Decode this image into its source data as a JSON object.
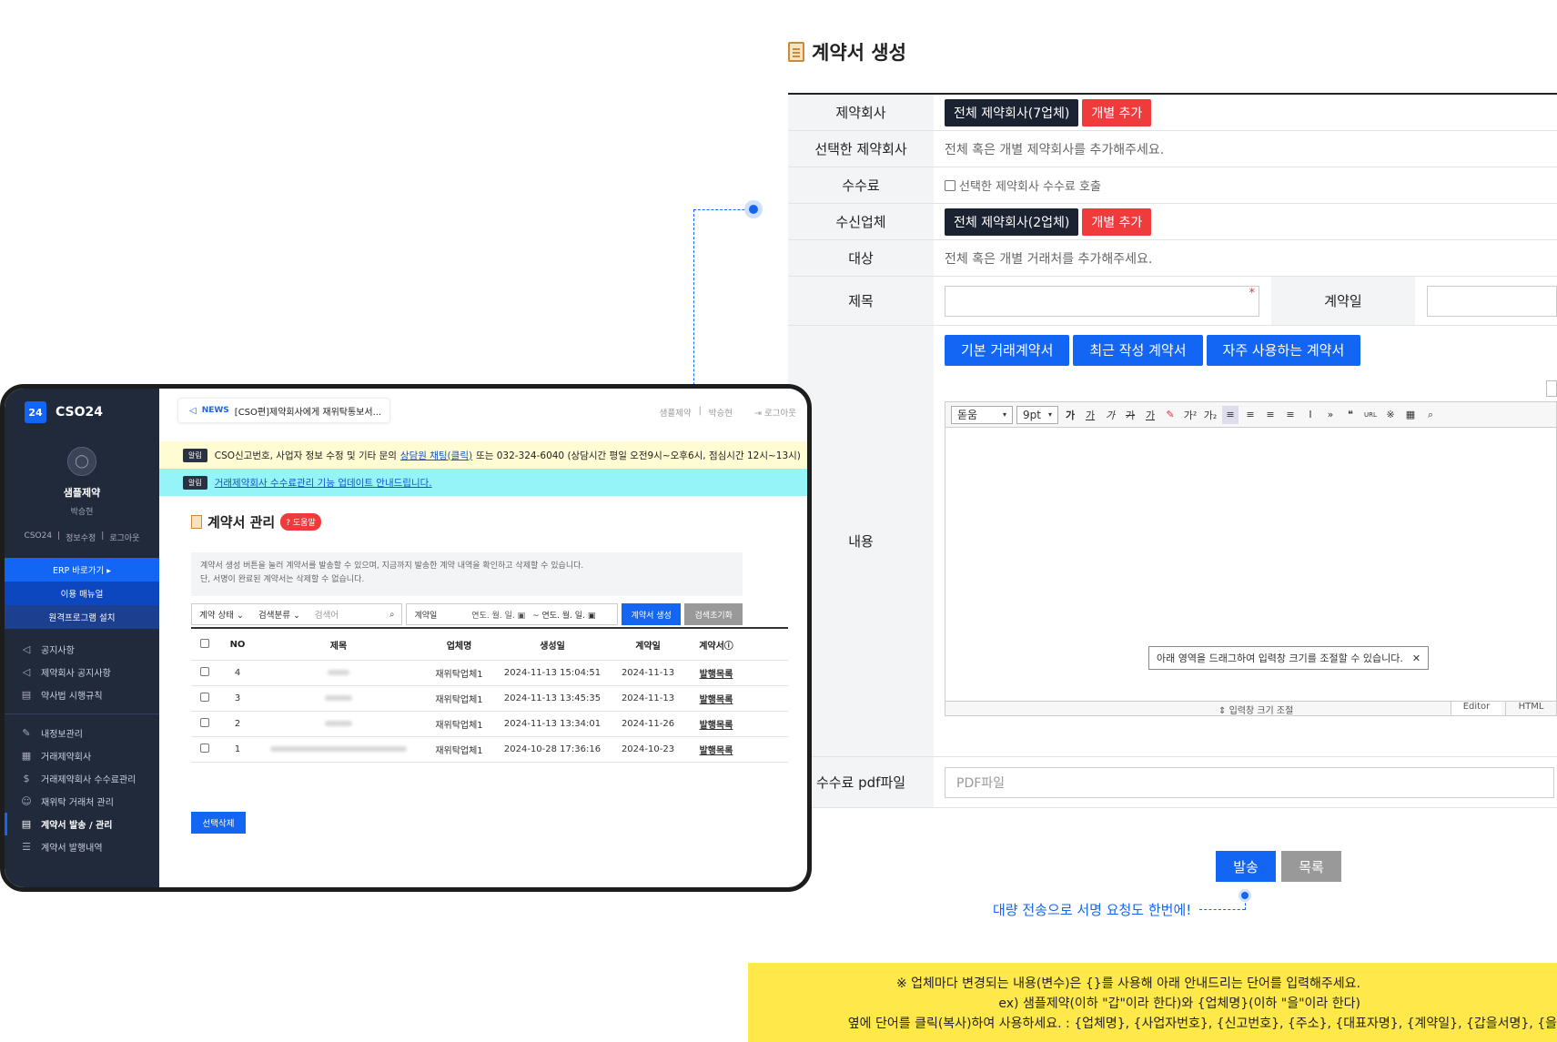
{
  "form": {
    "title": "계약서 생성",
    "rows": {
      "company_label": "제약회사",
      "company_all": "전체 제약회사(7업체)",
      "company_add": "개별 추가",
      "selected_label": "선택한 제약회사",
      "selected_placeholder": "전체 혹은 개별 제약회사를 추가해주세요.",
      "fee_label": "수수료",
      "fee_checkbox": "선택한 제약회사 수수료 호출",
      "receiver_label": "수신업체",
      "receiver_all": "전체 제약회사(2업체)",
      "receiver_add": "개별 추가",
      "target_label": "대상",
      "target_placeholder": "전체 혹은 개별 거래처를 추가해주세요.",
      "subject_label": "제목",
      "date_label": "계약일",
      "content_label": "내용",
      "pdf_label": "수수료 pdf파일",
      "pdf_placeholder": "PDF파일"
    },
    "template_buttons": [
      "기본 거래계약서",
      "최근 작성 계약서",
      "자주 사용하는 계약서"
    ],
    "editor": {
      "font": "돋움",
      "size": "9pt",
      "tooltip": "아래 영역을 드래그하여 입력창 크기를 조절할 수 있습니다.",
      "resize": "입력창 크기 조절",
      "tab_editor": "Editor",
      "tab_html": "HTML"
    },
    "send": "발송",
    "list": "목록",
    "callout": "대량 전송으로 서명 요청도 한번에!"
  },
  "note": {
    "line1": "※ 업체마다 변경되는 내용(변수)은 {}를 사용해 아래 안내드리는 단어를 입력해주세요.",
    "line2": "ex) 샘플제약(이하 \"갑\"이라 한다)와 {업체명}(이하 \"을\"이라 한다)",
    "line3": "옆에 단어를 클릭(복사)하여 사용하세요. : {업체명}, {사업자번호}, {신고번호}, {주소}, {대표자명}, {계약일}, {갑을서명}, {을"
  },
  "app": {
    "logo_badge": "24",
    "logo_text": "CSO24",
    "company": "샘플제약",
    "user": "박승현",
    "user_links": [
      "CSO24",
      "정보수정",
      "로그아웃"
    ],
    "quick_buttons": [
      "ERP 바로가기 ▸",
      "이용 매뉴얼",
      "원격프로그램 설치"
    ],
    "menu1": [
      "공지사항",
      "제약회사 공지사항",
      "약사법 시행규칙"
    ],
    "menu2": [
      "내정보관리",
      "거래제약회사",
      "거래제약회사 수수료관리",
      "재위탁 거래처 관리",
      "계약서 발송 / 관리",
      "계약서 발행내역"
    ],
    "news_label": "NEWS",
    "news_text": "[CSO편]제약회사에게 재위탁통보서...",
    "top_company": "샘플제약",
    "top_user": "박승현",
    "top_logout": "로그아웃",
    "alert_tag": "알림",
    "alert1_pre": "CSO신고번호, 사업자 정보 수정 및 기타 문의",
    "alert1_link": "상담원 채팅(클릭)",
    "alert1_post": "또는 032-324-6040 (상담시간 평일 오전9시~오후6시, 점심시간 12시~13시)",
    "alert2": "거래제약회사 수수료관리 기능 업데이트 안내드립니다.",
    "page_title": "계약서 관리",
    "help": "도움말",
    "info1": "계약서 생성 버튼을 눌러 계약서를 발송할 수 있으며, 지금까지 발송한 계약 내역을 확인하고 삭제할 수 있습니다.",
    "info2": "단, 서명이 완료된 계약서는 삭제할 수 없습니다.",
    "filter_status": "계약 상태",
    "filter_type": "검색분류",
    "filter_search": "검색어",
    "filter_date": "계약일",
    "date_ph": "연도. 월. 일.",
    "btn_create": "계약서 생성",
    "btn_reset": "검색초기화",
    "columns": [
      "NO",
      "제목",
      "업체명",
      "생성일",
      "계약일",
      "계약서"
    ],
    "rows": [
      {
        "no": "4",
        "company": "재위탁업체1",
        "created": "2024-11-13 15:04:51",
        "date": "2024-11-13",
        "doc": "발행목록"
      },
      {
        "no": "3",
        "company": "재위탁업체1",
        "created": "2024-11-13 13:45:35",
        "date": "2024-11-13",
        "doc": "발행목록"
      },
      {
        "no": "2",
        "company": "재위탁업체1",
        "created": "2024-11-13 13:34:01",
        "date": "2024-11-26",
        "doc": "발행목록"
      },
      {
        "no": "1",
        "company": "재위탁업체1",
        "created": "2024-10-28 17:36:16",
        "date": "2024-10-23",
        "doc": "발행목록"
      }
    ],
    "btn_delete": "선택삭제"
  }
}
